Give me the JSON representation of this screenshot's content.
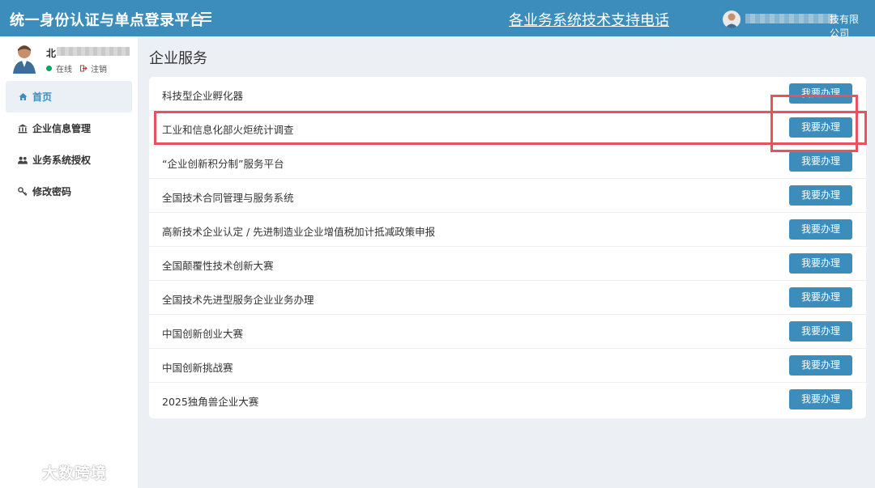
{
  "header": {
    "app_title": "统一身份认证与单点登录平台",
    "support_phone_link": "各业务系统技术支持电话",
    "company_suffix": "技有限公司",
    "background_color": "#3c8dbc"
  },
  "user_panel": {
    "name_prefix": "北",
    "status_online": "在线",
    "logout": "注销"
  },
  "sidebar": {
    "items": [
      {
        "label": "首页",
        "icon": "home-icon"
      },
      {
        "label": "企业信息管理",
        "icon": "bank-icon"
      },
      {
        "label": "业务系统授权",
        "icon": "users-icon"
      },
      {
        "label": "修改密码",
        "icon": "key-icon"
      }
    ]
  },
  "main": {
    "page_title": "企业服务",
    "button_label": "我要办理",
    "services": [
      "科技型企业孵化器",
      "工业和信息化部火炬统计调查",
      "“企业创新积分制”服务平台",
      "全国技术合同管理与服务系统",
      "高新技术企业认定 / 先进制造业企业增值税加计抵减政策申报",
      "全国颠覆性技术创新大赛",
      "全国技术先进型服务企业业务办理",
      "中国创新创业大赛",
      "中国创新挑战赛",
      "2025独角兽企业大赛"
    ]
  },
  "watermark": {
    "text": "大数跨境"
  },
  "colors": {
    "accent": "#3c8dbc",
    "highlight": "#e8525c",
    "online": "#00a65a"
  }
}
